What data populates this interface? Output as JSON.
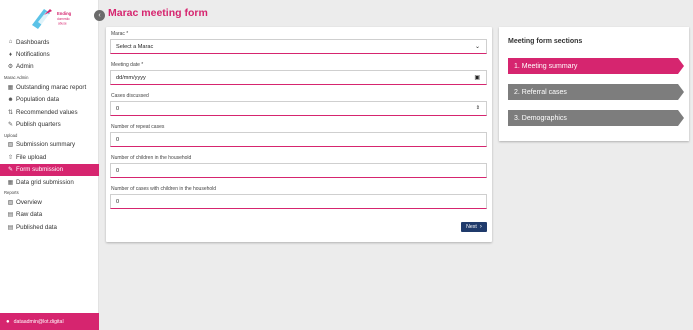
{
  "app": {
    "logo_text_1": "Ending",
    "logo_text_2": "domestic",
    "logo_text_3": "abuse"
  },
  "sidebar": {
    "main_items": [
      {
        "label": "Dashboards",
        "icon": "home-icon"
      },
      {
        "label": "Notifications",
        "icon": "bell-icon"
      },
      {
        "label": "Admin",
        "icon": "gear-icon"
      }
    ],
    "marac_admin_label": "Marac Admin",
    "marac_admin_items": [
      {
        "label": "Outstanding marac report",
        "icon": "report-icon"
      },
      {
        "label": "Population data",
        "icon": "people-icon"
      },
      {
        "label": "Recommended values",
        "icon": "sliders-icon"
      },
      {
        "label": "Publish quarters",
        "icon": "publish-icon"
      }
    ],
    "upload_label": "Upload",
    "upload_items": [
      {
        "label": "Submission summary",
        "icon": "file-icon"
      },
      {
        "label": "File upload",
        "icon": "upload-icon"
      },
      {
        "label": "Form submission",
        "icon": "edit-icon"
      },
      {
        "label": "Data grid submission",
        "icon": "grid-icon"
      }
    ],
    "reports_label": "Reports",
    "reports_items": [
      {
        "label": "Overview",
        "icon": "file-icon"
      },
      {
        "label": "Raw data",
        "icon": "data-icon"
      },
      {
        "label": "Published data",
        "icon": "published-icon"
      }
    ],
    "user_email": "dataadmin@lot.digital"
  },
  "page": {
    "title": "Marac meeting form"
  },
  "form": {
    "marac_label": "Marac *",
    "marac_value": "Select a Marac",
    "meeting_date_label": "Meeting date *",
    "meeting_date_value": "dd/mm/yyyy",
    "cases_discussed_label": "Cases discussed",
    "cases_discussed_value": "0",
    "repeat_cases_label": "Number of repeat cases",
    "repeat_cases_value": "0",
    "children_label": "Number of children in the household",
    "children_value": "0",
    "cases_with_children_label": "Number of cases with children in the household",
    "cases_with_children_value": "0",
    "next_label": "Next"
  },
  "sections": {
    "title": "Meeting form sections",
    "items": [
      {
        "label": "1. Meeting summary",
        "active": true
      },
      {
        "label": "2. Referral cases",
        "active": false
      },
      {
        "label": "3. Demographics",
        "active": false
      }
    ]
  },
  "colors": {
    "accent": "#d6256f",
    "button": "#1f3a6b",
    "inactive_tab": "#7d7d7d"
  }
}
